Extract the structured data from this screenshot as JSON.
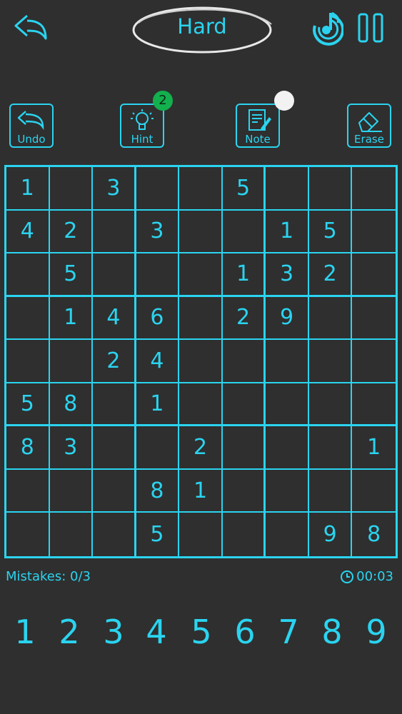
{
  "header": {
    "difficulty": "Hard"
  },
  "tools": {
    "undo_label": "Undo",
    "hint_label": "Hint",
    "hint_count": "2",
    "note_label": "Note",
    "erase_label": "Erase"
  },
  "board": [
    [
      "1",
      "",
      "3",
      "",
      "",
      "5",
      "",
      "",
      ""
    ],
    [
      "4",
      "2",
      "",
      "3",
      "",
      "",
      "1",
      "5",
      ""
    ],
    [
      "",
      "5",
      "",
      "",
      "",
      "1",
      "3",
      "2",
      ""
    ],
    [
      "",
      "1",
      "4",
      "6",
      "",
      "2",
      "9",
      "",
      ""
    ],
    [
      "",
      "",
      "2",
      "4",
      "",
      "",
      "",
      "",
      ""
    ],
    [
      "5",
      "8",
      "",
      "1",
      "",
      "",
      "",
      "",
      ""
    ],
    [
      "8",
      "3",
      "",
      "",
      "2",
      "",
      "",
      "",
      "1"
    ],
    [
      "",
      "",
      "",
      "8",
      "1",
      "",
      "",
      "",
      ""
    ],
    [
      "",
      "",
      "",
      "5",
      "",
      "",
      "",
      "9",
      "8"
    ]
  ],
  "status": {
    "mistakes": "Mistakes: 0/3",
    "timer": "00:03"
  },
  "numpad": [
    "1",
    "2",
    "3",
    "4",
    "5",
    "6",
    "7",
    "8",
    "9"
  ],
  "colors": {
    "accent": "#2ad4f0",
    "background": "#2f2f2f",
    "badge": "#13b04e"
  },
  "icons": {
    "back": "undo-arrow-icon",
    "music": "music-note-icon",
    "pause": "pause-icon"
  }
}
